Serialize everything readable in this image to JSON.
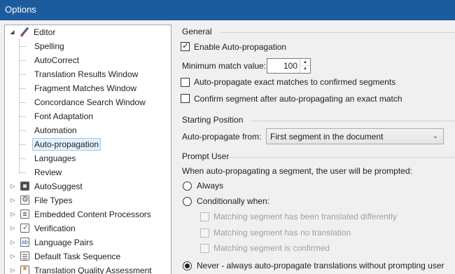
{
  "window": {
    "title": "Options"
  },
  "tree": {
    "items": [
      {
        "label": "Editor",
        "icon": "pencil-icon"
      },
      {
        "label": "Spelling"
      },
      {
        "label": "AutoCorrect"
      },
      {
        "label": "Translation Results Window"
      },
      {
        "label": "Fragment Matches Window"
      },
      {
        "label": "Concordance Search Window"
      },
      {
        "label": "Font Adaptation"
      },
      {
        "label": "Automation"
      },
      {
        "label": "Auto-propagation",
        "selected": true
      },
      {
        "label": "Languages"
      },
      {
        "label": "Review"
      },
      {
        "label": "AutoSuggest",
        "icon": "autosuggest-icon"
      },
      {
        "label": "File Types",
        "icon": "file-types-icon"
      },
      {
        "label": "Embedded Content Processors",
        "icon": "embedded-content-icon"
      },
      {
        "label": "Verification",
        "icon": "verification-icon"
      },
      {
        "label": "Language Pairs",
        "icon": "language-pairs-icon"
      },
      {
        "label": "Default Task Sequence",
        "icon": "task-sequence-icon"
      },
      {
        "label": "Translation Quality Assessment",
        "icon": "tqa-icon"
      }
    ]
  },
  "general": {
    "header": "General",
    "enable_label": "Enable Auto-propagation",
    "enable_checked": true,
    "min_match_label": "Minimum match value:",
    "min_match_value": "100",
    "exact_confirmed_label": "Auto-propagate exact matches to confirmed segments",
    "exact_confirmed_checked": false,
    "confirm_segment_label": "Confirm segment after auto-propagating an exact match",
    "confirm_segment_checked": false
  },
  "starting_position": {
    "header": "Starting Position",
    "from_label": "Auto-propagate from:",
    "from_value": "First segment in the document"
  },
  "prompt_user": {
    "header": "Prompt User",
    "description": "When auto-propagating a segment, the user will be prompted:",
    "always_label": "Always",
    "conditionally_label": "Conditionally when:",
    "cond_translated_differently": "Matching segment has been translated differently",
    "cond_no_translation": "Matching segment has no translation",
    "cond_confirmed": "Matching segment is confirmed",
    "never_label": "Never - always auto-propagate translations without prompting user",
    "selected": "never"
  }
}
